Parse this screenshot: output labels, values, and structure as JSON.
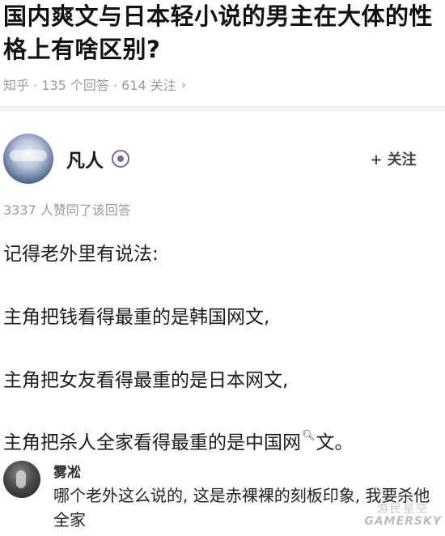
{
  "question": {
    "title": "国内爽文与日本轻小说的男主在大体的性格上有啥区别?",
    "meta": "知乎 · 135 个回答 · 614 关注",
    "chevron_icon": "chevron-right-icon"
  },
  "author": {
    "name": "凡人",
    "badge_icon": "badge-icon",
    "follow_label": "+ 关注"
  },
  "upvotes": "3337 人赞同了该回答",
  "answer": {
    "p1": "记得老外里有说法:",
    "p2": "主角把钱看得最重的是韩国网文,",
    "p3": "主角把女友看得最重的是日本网文,",
    "p4_before": "主角把杀人全家看得最重的是中国网",
    "p4_after": "文。",
    "search_icon": "search-icon"
  },
  "comment": {
    "name": "雾凇",
    "text": "哪个老外这么说的, 这是赤裸裸的刻板印象, 我要杀他全家"
  },
  "watermark": {
    "top": "游民星空",
    "main": "GAMERSKY"
  }
}
